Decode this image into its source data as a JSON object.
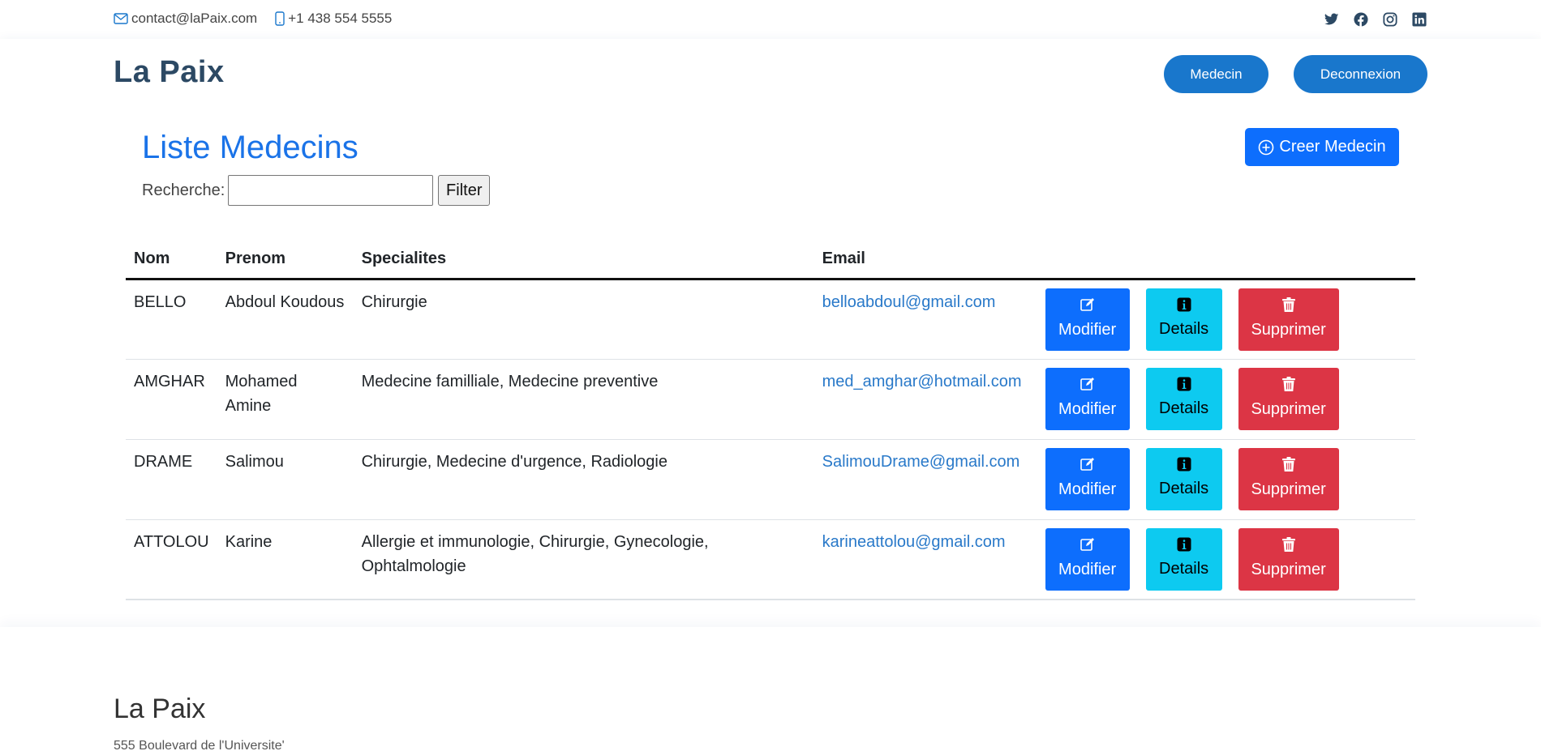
{
  "topbar": {
    "email": "contact@laPaix.com",
    "phone": "+1 438 554 5555",
    "social": [
      "twitter-icon",
      "facebook-icon",
      "instagram-icon",
      "linkedin-icon"
    ]
  },
  "header": {
    "logo": "La Paix",
    "nav_medecin": "Medecin",
    "nav_deconnexion": "Deconnexion"
  },
  "main": {
    "title": "Liste Medecins",
    "create_label": "Creer Medecin",
    "search_label": "Recherche:",
    "search_value": "",
    "filter_label": "Filter",
    "columns": [
      "Nom",
      "Prenom",
      "Specialites",
      "Email"
    ],
    "action_labels": {
      "modifier": "Modifier",
      "details": "Details",
      "supprimer": "Supprimer"
    },
    "rows": [
      {
        "nom": "BELLO",
        "prenom": "Abdoul Koudous",
        "specialites": "Chirurgie",
        "email": "belloabdoul@gmail.com"
      },
      {
        "nom": "AMGHAR",
        "prenom": "Mohamed Amine",
        "specialites": "Medecine familliale, Medecine preventive",
        "email": "med_amghar@hotmail.com"
      },
      {
        "nom": "DRAME",
        "prenom": "Salimou",
        "specialites": "Chirurgie, Medecine d'urgence, Radiologie",
        "email": "SalimouDrame@gmail.com"
      },
      {
        "nom": "ATTOLOU",
        "prenom": "Karine",
        "specialites": "Allergie et immunologie, Chirurgie, Gynecologie, Ophtalmologie",
        "email": "karineattolou@gmail.com"
      }
    ]
  },
  "footer": {
    "title": "La Paix",
    "address": "555 Boulevard de l'Universite'"
  },
  "colors": {
    "brand": "#1977cc",
    "primary": "#0d6efd",
    "info": "#0dcaf0",
    "danger": "#dc3545",
    "title": "#1a73e8",
    "logo": "#2c4964"
  }
}
